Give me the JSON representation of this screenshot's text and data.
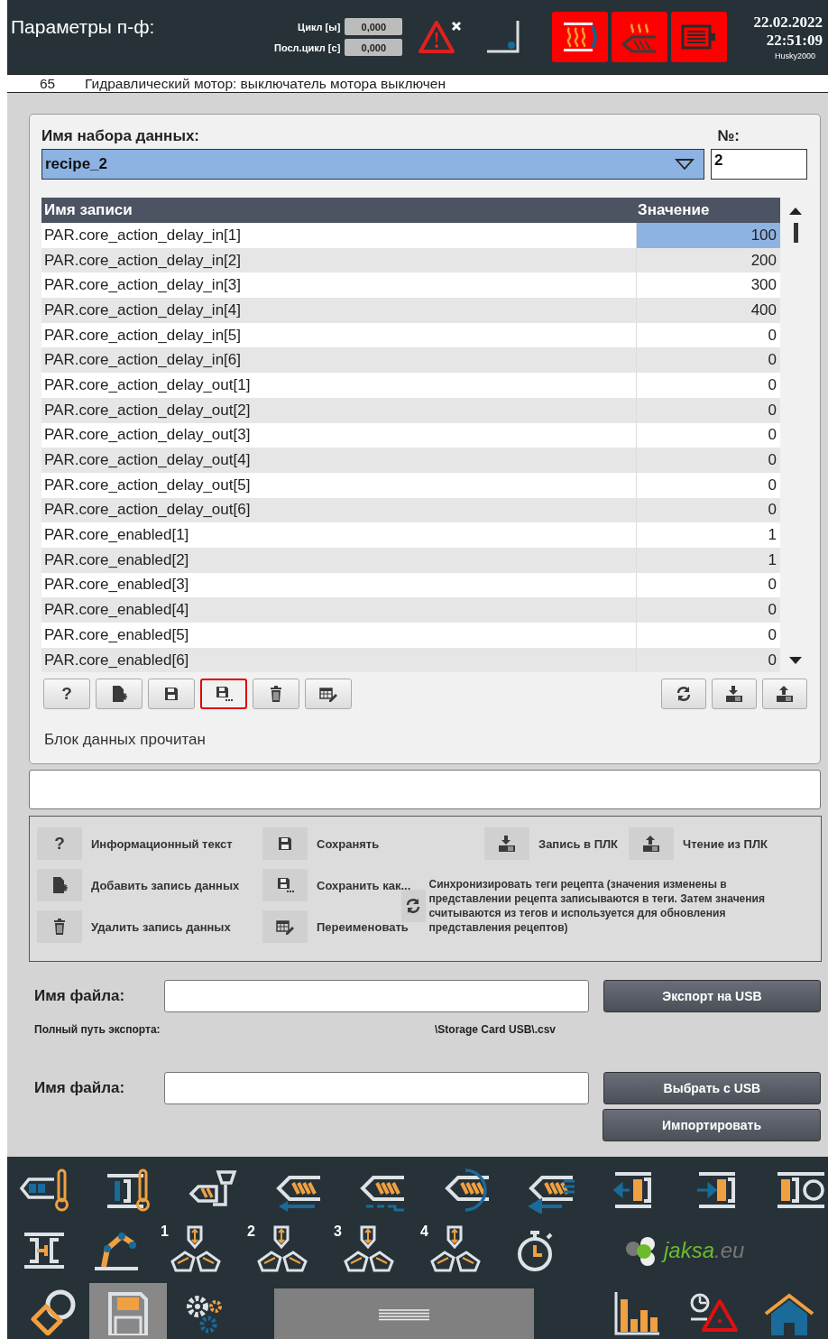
{
  "header": {
    "title": "Параметры п-ф:",
    "cycle_rows": [
      {
        "label": "Цикл [ы]",
        "value": "0,000"
      },
      {
        "label": "Посл.цикл [с]",
        "value": "0,000"
      }
    ],
    "status_tiles": [
      {
        "kind": "barrel-heat",
        "on": true
      },
      {
        "kind": "nozzle-heat",
        "on": true
      },
      {
        "kind": "motor",
        "on": true
      }
    ],
    "date": "22.02.2022",
    "time": "22:51:09",
    "device": "Husky2000"
  },
  "message": {
    "code": "65",
    "text": "Гидравлический мотор: выключатель мотора выключен"
  },
  "dataset": {
    "label": "Имя набора данных:",
    "value": "recipe_2",
    "number_label": "№:",
    "number": "2"
  },
  "table": {
    "columns": [
      "Имя записи",
      "Значение"
    ],
    "rows": [
      {
        "name": "PAR.core_action_delay_in[1]",
        "value": "100",
        "selected": true
      },
      {
        "name": "PAR.core_action_delay_in[2]",
        "value": "200",
        "selected": false
      },
      {
        "name": "PAR.core_action_delay_in[3]",
        "value": "300",
        "selected": false
      },
      {
        "name": "PAR.core_action_delay_in[4]",
        "value": "400",
        "selected": false
      },
      {
        "name": "PAR.core_action_delay_in[5]",
        "value": "0",
        "selected": false
      },
      {
        "name": "PAR.core_action_delay_in[6]",
        "value": "0",
        "selected": false
      },
      {
        "name": "PAR.core_action_delay_out[1]",
        "value": "0",
        "selected": false
      },
      {
        "name": "PAR.core_action_delay_out[2]",
        "value": "0",
        "selected": false
      },
      {
        "name": "PAR.core_action_delay_out[3]",
        "value": "0",
        "selected": false
      },
      {
        "name": "PAR.core_action_delay_out[4]",
        "value": "0",
        "selected": false
      },
      {
        "name": "PAR.core_action_delay_out[5]",
        "value": "0",
        "selected": false
      },
      {
        "name": "PAR.core_action_delay_out[6]",
        "value": "0",
        "selected": false
      },
      {
        "name": "PAR.core_enabled[1]",
        "value": "1",
        "selected": false
      },
      {
        "name": "PAR.core_enabled[2]",
        "value": "1",
        "selected": false
      },
      {
        "name": "PAR.core_enabled[3]",
        "value": "0",
        "selected": false
      },
      {
        "name": "PAR.core_enabled[4]",
        "value": "0",
        "selected": false
      },
      {
        "name": "PAR.core_enabled[5]",
        "value": "0",
        "selected": false
      },
      {
        "name": "PAR.core_enabled[6]",
        "value": "0",
        "selected": false
      }
    ]
  },
  "toolbar_left": [
    {
      "kind": "help",
      "label": "?",
      "highlighted": false
    },
    {
      "kind": "new",
      "highlighted": false
    },
    {
      "kind": "save",
      "highlighted": false
    },
    {
      "kind": "save-as",
      "highlighted": true
    },
    {
      "kind": "delete",
      "highlighted": false
    },
    {
      "kind": "rename",
      "highlighted": false
    }
  ],
  "toolbar_right": [
    {
      "kind": "sync",
      "highlighted": false
    },
    {
      "kind": "download",
      "highlighted": false
    },
    {
      "kind": "upload",
      "highlighted": false
    }
  ],
  "status_text": "Блок данных прочитан",
  "legend": {
    "items": [
      {
        "kind": "help",
        "icon_label": "?",
        "label": "Информационный текст"
      },
      {
        "kind": "save",
        "label": "Сохранять"
      },
      {
        "kind": "download",
        "label": "Запись в ПЛК"
      },
      {
        "kind": "upload",
        "label": "Чтение из ПЛК"
      },
      {
        "kind": "new",
        "label": "Добавить запись данных"
      },
      {
        "kind": "save-as",
        "label": "Сохранить как..."
      },
      {
        "kind": "delete",
        "label": "Удалить запись данных"
      },
      {
        "kind": "rename",
        "label": "Переименовать"
      }
    ],
    "sync_text": "Синхронизировать теги рецепта (значения изменены в представлении рецепта записываются в теги. Затем значения считываются из тегов и используется для обновления представления рецептов)"
  },
  "export": {
    "label": "Имя файла:",
    "button": "Экспорт на USB",
    "path_label": "Полный путь экспорта:",
    "path": "\\Storage Card USB\\.csv"
  },
  "import": {
    "label": "Имя файла:",
    "buttons": [
      "Выбрать с USB",
      "Импортировать"
    ]
  },
  "nav": {
    "row_1": [
      {
        "kind": "barrel-temp",
        "selected": false
      },
      {
        "kind": "mold-temp",
        "selected": false
      },
      {
        "kind": "hopper",
        "selected": false
      },
      {
        "kind": "injection",
        "selected": false
      },
      {
        "kind": "holding",
        "selected": false
      },
      {
        "kind": "screw-rotation",
        "selected": false
      },
      {
        "kind": "decompression",
        "selected": false
      },
      {
        "kind": "mold-open",
        "selected": false
      },
      {
        "kind": "mold-close",
        "selected": false
      },
      {
        "kind": "mold-cycle",
        "selected": false
      }
    ],
    "row_2": [
      {
        "kind": "ejector",
        "selected": false
      },
      {
        "kind": "robot",
        "selected": false
      },
      {
        "kind": "core",
        "number": "1",
        "selected": false
      },
      {
        "kind": "core",
        "number": "2",
        "selected": false
      },
      {
        "kind": "core",
        "number": "3",
        "selected": false
      },
      {
        "kind": "core",
        "number": "4",
        "selected": false
      },
      {
        "kind": "timer",
        "selected": false
      }
    ],
    "logo": {
      "name": "jaksa",
      "suffix": ".eu"
    },
    "row_3": [
      {
        "kind": "service",
        "selected": false
      },
      {
        "kind": "save",
        "selected": true
      },
      {
        "kind": "settings",
        "selected": false
      },
      {
        "kind": "handle",
        "selected": false
      },
      {
        "kind": "chart",
        "selected": false
      },
      {
        "kind": "alarms",
        "selected": false
      },
      {
        "kind": "home",
        "selected": false
      }
    ]
  }
}
